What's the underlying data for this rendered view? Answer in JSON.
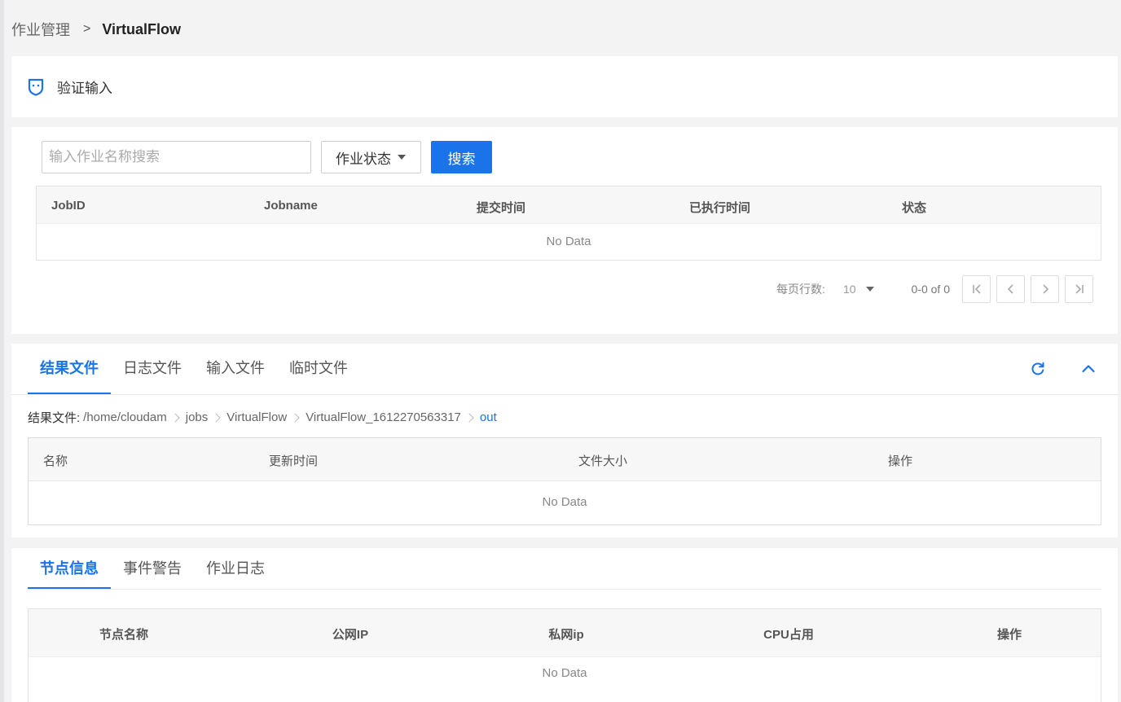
{
  "breadcrumb": {
    "parent": "作业管理",
    "separator": ">",
    "current": "VirtualFlow"
  },
  "title_card": {
    "title": "验证输入",
    "icon": "shield-icon"
  },
  "jobs": {
    "search_placeholder": "输入作业名称搜索",
    "status_dropdown": "作业状态",
    "search_button": "搜索",
    "columns": [
      "JobID",
      "Jobname",
      "提交时间",
      "已执行时间",
      "状态"
    ],
    "empty_text": "No Data",
    "pagination": {
      "rows_label": "每页行数:",
      "rows_value": "10",
      "range": "0-0 of 0"
    }
  },
  "files": {
    "tabs": [
      "结果文件",
      "日志文件",
      "输入文件",
      "临时文件"
    ],
    "active_tab": "结果文件",
    "path_label": "结果文件:",
    "path": [
      "/home/cloudam",
      "jobs",
      "VirtualFlow",
      "VirtualFlow_1612270563317",
      "out"
    ],
    "columns": [
      "名称",
      "更新时间",
      "文件大小",
      "操作"
    ],
    "empty_text": "No Data"
  },
  "nodes": {
    "tabs": [
      "节点信息",
      "事件警告",
      "作业日志"
    ],
    "active_tab": "节点信息",
    "columns": [
      "节点名称",
      "公网IP",
      "私网ip",
      "CPU占用",
      "操作"
    ],
    "empty_text": "No Data"
  },
  "colors": {
    "accent": "#1a73e8",
    "background": "#f3f3f4"
  }
}
